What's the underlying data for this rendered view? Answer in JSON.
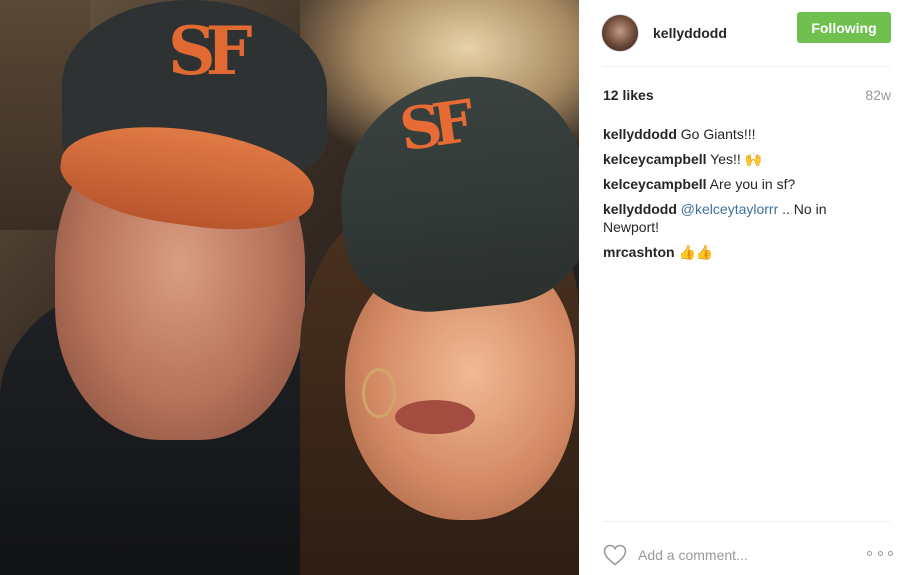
{
  "post": {
    "photo_alt": "",
    "author": {
      "username": "kellyddodd",
      "follow_label": "Following"
    },
    "likes": "12 likes",
    "time_ago": "82w",
    "comments": [
      {
        "user": "kellyddodd",
        "text": "Go Giants!!!"
      },
      {
        "user": "kelceycampbell",
        "text": "Yes!! 🙌"
      },
      {
        "user": "kelceycampbell",
        "text": "Are you in sf?"
      },
      {
        "user": "kellyddodd",
        "mention": "@kelceytaylorrr",
        "text": ".. No in Newport!"
      },
      {
        "user": "mrcashton",
        "text": "👍👍"
      }
    ],
    "add_comment_placeholder": "Add a comment...",
    "icons": {
      "like": "heart-icon",
      "more": "more-options-icon"
    },
    "colors": {
      "follow_button": "#70c050",
      "mention": "#3f729b",
      "muted": "#999999"
    },
    "photo_logo_text": "SF"
  }
}
